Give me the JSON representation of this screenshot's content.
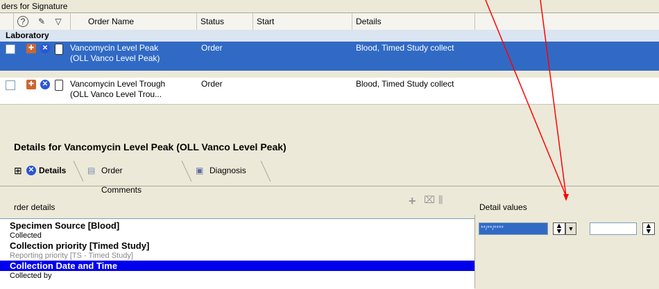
{
  "window": {
    "caption": "ders for Signature"
  },
  "grid": {
    "headers": {
      "order_name": "Order Name",
      "status": "Status",
      "start": "Start",
      "details": "Details"
    },
    "header_icons": {
      "help": "?",
      "edit": "✎",
      "filter": "▽"
    },
    "section_label": "Laboratory",
    "rows": [
      {
        "name_line1": "Vancomycin Level Peak",
        "name_line2": "(OLL Vanco Level Peak)",
        "status": "Order",
        "details": "Blood, Timed Study collect",
        "selected": true
      },
      {
        "name_line1": "Vancomycin Level Trough",
        "name_line2": "(OLL Vanco Level Trou...",
        "status": "Order",
        "details": "Blood, Timed Study collect",
        "selected": false
      }
    ]
  },
  "details": {
    "title": "Details for Vancomycin Level Peak (OLL Vanco Level Peak)",
    "tabs": [
      {
        "label": "Details",
        "active": true
      },
      {
        "label": "Order Comments"
      },
      {
        "label": "Diagnosis"
      }
    ],
    "order_details_label": "rder details",
    "detail_values_label": "Detail values",
    "toolbar_icons": {
      "add": "+",
      "remove": "trash",
      "chart": "lln"
    },
    "order_detail_rows": [
      {
        "head": "Specimen Source  [Blood]",
        "sub": "Collected"
      },
      {
        "head": "Collection priority  [Timed Study]",
        "sub": "Reporting priority  [TS - Timed Study]"
      },
      {
        "head": "Collection Date and Time",
        "sub": "Collected by"
      }
    ],
    "date_placeholder": "**/**/****"
  },
  "colors": {
    "selection": "#316ac5",
    "bright_selection": "#0000ee",
    "annotation_arrow": "#ff0000"
  }
}
